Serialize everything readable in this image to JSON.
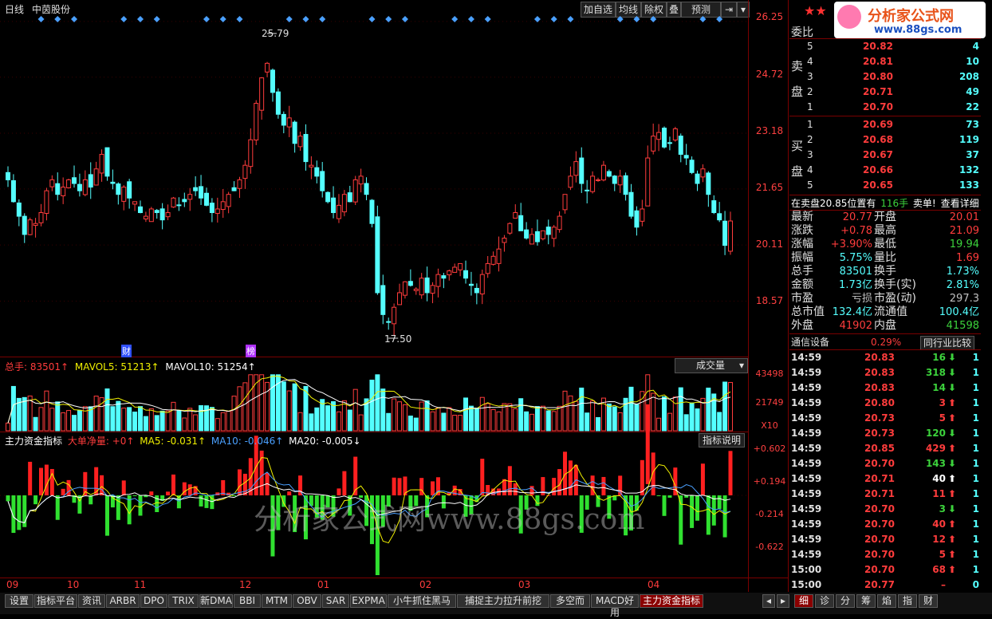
{
  "header": {
    "period": "日线",
    "stock_name": "中茵股份",
    "buttons": [
      "加自选",
      "均线",
      "除权",
      "叠",
      "预测"
    ],
    "logo_text": "分析家公式网",
    "logo_url": "www.88gs.com"
  },
  "main_chart": {
    "price_axis": [
      "26.25",
      "24.72",
      "23.18",
      "21.65",
      "20.11",
      "18.57"
    ],
    "high_label": "25.79",
    "low_label": "17.50",
    "markers": [
      "财",
      "榜"
    ]
  },
  "volume_panel": {
    "legend": {
      "total": "总手: 83501↑",
      "mavol5": "MAVOL5: 51213↑",
      "mavol10": "MAVOL10: 51254↑"
    },
    "dropdown": "成交量",
    "axis": [
      "43498",
      "21749",
      "X10"
    ]
  },
  "fund_panel": {
    "legend": {
      "name": "主力资金指标",
      "big": "大单净量: +0↑",
      "ma5": "MA5: -0.031↑",
      "ma10": "MA10: -0.046↑",
      "ma20": "MA20: -0.005↓"
    },
    "button": "指标说明",
    "axis": [
      "+0.602",
      "+0.194",
      "-0.214",
      "-0.622"
    ],
    "watermark": "分析家公式网www.88gs.com"
  },
  "x_axis": [
    "09",
    "10",
    "11",
    "12",
    "01",
    "02",
    "03",
    "04"
  ],
  "chart_data": {
    "type": "candlestick",
    "title": "中茵股份",
    "ylim": [
      17.2,
      26.4
    ],
    "closes": [
      21.9,
      21.3,
      20.9,
      20.4,
      20.8,
      20.7,
      21.0,
      21.6,
      21.9,
      21.5,
      21.7,
      21.9,
      21.8,
      21.6,
      21.9,
      21.7,
      22.2,
      22.6,
      22.0,
      21.8,
      21.5,
      21.7,
      21.4,
      21.3,
      21.0,
      20.9,
      21.1,
      21.0,
      20.8,
      21.0,
      21.4,
      21.2,
      21.3,
      21.5,
      21.6,
      21.4,
      21.2,
      21.0,
      21.1,
      21.3,
      21.5,
      21.6,
      21.9,
      22.3,
      23.0,
      24.0,
      24.7,
      25.1,
      24.3,
      23.7,
      23.4,
      23.6,
      22.9,
      23.1,
      22.4,
      22.3,
      22.0,
      21.6,
      21.3,
      21.0,
      21.2,
      21.5,
      21.3,
      21.9,
      22.0,
      21.5,
      20.7,
      18.8,
      18.2,
      18.0,
      18.4,
      18.8,
      19.1,
      19.0,
      18.9,
      19.2,
      18.8,
      19.0,
      19.3,
      19.2,
      19.4,
      19.5,
      19.6,
      19.2,
      19.0,
      18.8,
      19.3,
      19.6,
      19.8,
      20.0,
      20.3,
      20.7,
      21.0,
      20.5,
      20.3,
      20.4,
      20.2,
      20.5,
      20.4,
      20.6,
      20.9,
      21.5,
      22.0,
      22.4,
      21.8,
      21.6,
      22.0,
      21.9,
      22.3,
      22.0,
      21.8,
      22.0,
      21.5,
      20.9,
      20.6,
      21.1,
      22.5,
      23.1,
      23.2,
      22.8,
      22.9,
      23.3,
      22.6,
      22.5,
      22.1,
      21.8,
      22.2,
      21.5,
      21.0,
      20.8,
      20.1,
      20.77
    ],
    "volume_legend": {
      "total": 83501,
      "mavol5": 51213,
      "mavol10": 51254
    },
    "fund_legend": {
      "big": 0,
      "ma5": -0.031,
      "ma10": -0.046,
      "ma20": -0.005
    }
  },
  "right_panel": {
    "weibi_label": "委比",
    "sell_label": [
      "卖",
      "盘"
    ],
    "buy_label": [
      "买",
      "盘"
    ],
    "sell_levels": [
      {
        "lvl": "5",
        "px": "20.82",
        "vol": "4"
      },
      {
        "lvl": "4",
        "px": "20.81",
        "vol": "10"
      },
      {
        "lvl": "3",
        "px": "20.80",
        "vol": "208"
      },
      {
        "lvl": "2",
        "px": "20.71",
        "vol": "49"
      },
      {
        "lvl": "1",
        "px": "20.70",
        "vol": "22"
      }
    ],
    "buy_levels": [
      {
        "lvl": "1",
        "px": "20.69",
        "vol": "73"
      },
      {
        "lvl": "2",
        "px": "20.68",
        "vol": "119"
      },
      {
        "lvl": "3",
        "px": "20.67",
        "vol": "37"
      },
      {
        "lvl": "4",
        "px": "20.66",
        "vol": "132"
      },
      {
        "lvl": "5",
        "px": "20.65",
        "vol": "133"
      }
    ],
    "notice": {
      "text": "在卖盘20.85位置有",
      "qty": "116手",
      "sell": "卖单!",
      "detail": "查看详细"
    },
    "stats": [
      {
        "l": "最新",
        "v": "20.77",
        "c": "red",
        "l2": "开盘",
        "v2": "20.01",
        "c2": "red"
      },
      {
        "l": "涨跌",
        "v": "+0.78",
        "c": "red",
        "l2": "最高",
        "v2": "21.09",
        "c2": "red"
      },
      {
        "l": "涨幅",
        "v": "+3.90%",
        "c": "red",
        "l2": "最低",
        "v2": "19.94",
        "c2": "green"
      },
      {
        "l": "振幅",
        "v": "5.75%",
        "c": "cyan",
        "l2": "量比",
        "v2": "1.69",
        "c2": "red"
      },
      {
        "l": "总手",
        "v": "83501",
        "c": "cyan",
        "l2": "换手",
        "v2": "1.73%",
        "c2": "cyan"
      },
      {
        "l": "金额",
        "v": "1.73亿",
        "c": "cyan",
        "l2": "换手(实)",
        "v2": "2.81%",
        "c2": "cyan"
      },
      {
        "l": "市盈",
        "v": "亏损",
        "c": "grey",
        "l2": "市盈(动)",
        "v2": "297.3",
        "c2": "grey"
      },
      {
        "l": "总市值",
        "v": "132.4亿",
        "c": "cyan",
        "l2": "流通值",
        "v2": "100.4亿",
        "c2": "cyan"
      },
      {
        "l": "外盘",
        "v": "41902",
        "c": "red",
        "l2": "内盘",
        "v2": "41598",
        "c2": "green"
      }
    ],
    "sector": {
      "name": "通信设备",
      "pct": "0.29%",
      "compare": "同行业比较"
    },
    "ticks": [
      {
        "t": "14:59",
        "p": "20.83",
        "pc": "red",
        "v": "16",
        "a": "down",
        "n": "1"
      },
      {
        "t": "14:59",
        "p": "20.83",
        "pc": "red",
        "v": "318",
        "a": "down",
        "n": "1"
      },
      {
        "t": "14:59",
        "p": "20.83",
        "pc": "red",
        "v": "14",
        "a": "down",
        "n": "1"
      },
      {
        "t": "14:59",
        "p": "20.80",
        "pc": "red",
        "v": "3",
        "a": "up",
        "n": "1"
      },
      {
        "t": "14:59",
        "p": "20.73",
        "pc": "red",
        "v": "5",
        "a": "up",
        "n": "1"
      },
      {
        "t": "14:59",
        "p": "20.73",
        "pc": "red",
        "v": "120",
        "a": "down",
        "n": "1"
      },
      {
        "t": "14:59",
        "p": "20.85",
        "pc": "red",
        "v": "429",
        "a": "up",
        "n": "1"
      },
      {
        "t": "14:59",
        "p": "20.70",
        "pc": "red",
        "v": "143",
        "a": "down",
        "n": "1"
      },
      {
        "t": "14:59",
        "p": "20.71",
        "pc": "red",
        "v": "40",
        "a": "upw",
        "n": "1"
      },
      {
        "t": "14:59",
        "p": "20.71",
        "pc": "red",
        "v": "11",
        "a": "up",
        "n": "1"
      },
      {
        "t": "14:59",
        "p": "20.70",
        "pc": "red",
        "v": "3",
        "a": "down",
        "n": "1"
      },
      {
        "t": "14:59",
        "p": "20.70",
        "pc": "red",
        "v": "40",
        "a": "up",
        "n": "1"
      },
      {
        "t": "14:59",
        "p": "20.70",
        "pc": "red",
        "v": "12",
        "a": "up",
        "n": "1"
      },
      {
        "t": "14:59",
        "p": "20.70",
        "pc": "red",
        "v": "5",
        "a": "up",
        "n": "1"
      },
      {
        "t": "15:00",
        "p": "20.70",
        "pc": "red",
        "v": "68",
        "a": "up",
        "n": "1"
      },
      {
        "t": "15:00",
        "p": "20.77",
        "pc": "red",
        "v": "–",
        "a": "none",
        "n": "0"
      }
    ],
    "tabs": [
      "细",
      "诊",
      "分",
      "筹",
      "焰",
      "指",
      "财"
    ]
  },
  "bottom_tabs": [
    "设置",
    "指标平台",
    "资讯",
    "ARBR",
    "DPO",
    "TRIX",
    "新DMA",
    "BBI",
    "MTM",
    "OBV",
    "SAR",
    "EXPMA",
    "小牛抓住黑马",
    "捕捉主力拉升前挖",
    "多空而",
    "MACD好用",
    "主力资金指标"
  ],
  "colors": {
    "up": "#ff3c3c",
    "down": "#54ffff",
    "frame": "#7a0000",
    "active_tab": "#8a0000"
  }
}
